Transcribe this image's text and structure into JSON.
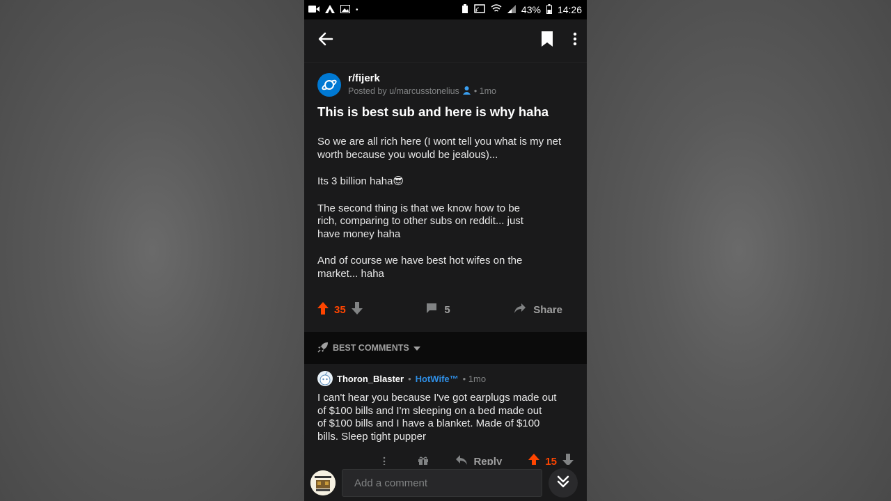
{
  "status": {
    "battery": "43%",
    "time": "14:26"
  },
  "post": {
    "subreddit": "r/fijerk",
    "posted_by": "Posted by u/marcusstonelius",
    "age": "• 1mo",
    "title": "This is best sub and here is why haha",
    "paragraphs": [
      "So we are all rich here (I wont tell you what is my net worth because you would be jealous)...",
      "Its 3 billion haha😎",
      "The second thing is that we know how to be\nrich, comparing to other subs on reddit... just\nhave money haha",
      "And of course we have best hot wifes on the\nmarket... haha"
    ],
    "score": "35",
    "comment_count": "5",
    "share_label": "Share"
  },
  "sort": {
    "label": "BEST COMMENTS"
  },
  "comment": {
    "user": "Thoron_Blaster",
    "sep": "•",
    "flair": "HotWife™",
    "age": "• 1mo",
    "body": "I can't hear you because I've got earplugs made out\nof $100 bills and I'm sleeping on a bed made out\nof $100 bills and I have a blanket. Made of $100\nbills. Sleep tight pupper",
    "reply_label": "Reply",
    "score": "15"
  },
  "compose": {
    "placeholder": "Add a comment"
  },
  "colors": {
    "upvote": "#ff4500",
    "flair": "#2f8fe6",
    "sub_icon": "#0079d3"
  }
}
